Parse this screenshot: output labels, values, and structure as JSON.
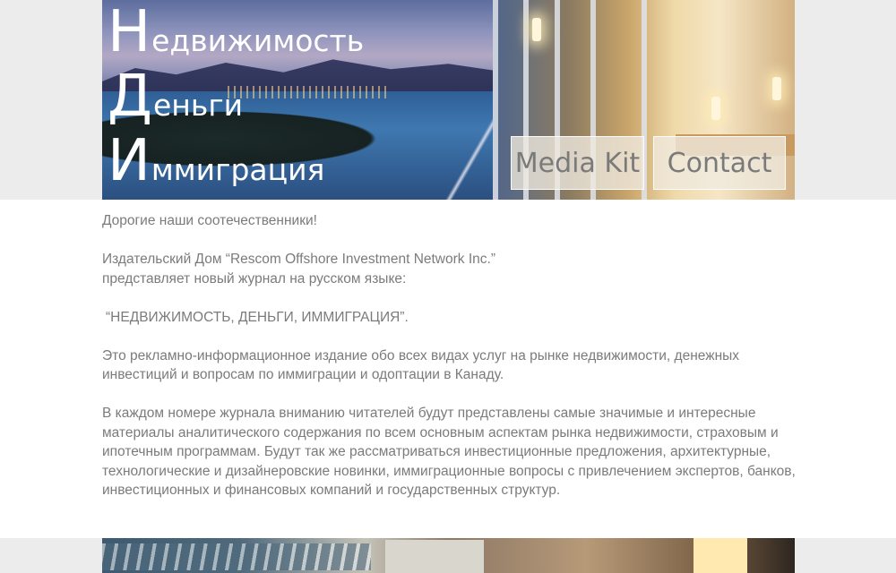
{
  "header": {
    "title_lines": [
      {
        "cap": "Н",
        "rest": "едвижимость"
      },
      {
        "cap": "Д",
        "rest": "еньги"
      },
      {
        "cap": "И",
        "rest": "ммиграция"
      }
    ]
  },
  "nav": {
    "media_kit": "Media Kit",
    "contact": "Contact"
  },
  "content": {
    "greeting": "Дорогие наши соотечественники!",
    "intro_line1": "Издательский Дом “Rescom Offshore Investment Network Inc.”",
    "intro_line2": "представляет новый журнал на русском языке:",
    "magazine_name": "“НЕДВИЖИМОСТЬ, ДЕНЬГИ, ИММИГРАЦИЯ”.",
    "paragraph1": "Это рекламно-информационное издание обо всех видах услуг на рынке недвижимости, денежных инвестиций и вопросам по иммиграции и одоптации в Канаду.",
    "paragraph2": "В каждом номере журнала вниманию читателей будут представлены самые значимые и интересные материалы аналитического содержания по всем основным аспектам рынка недвижимости, страховым и ипотечным программам. Будут так же рассматриваться инвестиционные предложения, архитектурные, технологические и дизайнеровские новинки, иммиграционные вопросы с привлечением экспертов, банков, инвестиционных и финансовых компаний и государственных структур."
  },
  "colors": {
    "background": "#ffffff",
    "band": "#ececec",
    "text": "#7b7b7b",
    "title": "#ffffff",
    "button_bg": "#f0eae0",
    "button_text": "#7a7a7a"
  }
}
